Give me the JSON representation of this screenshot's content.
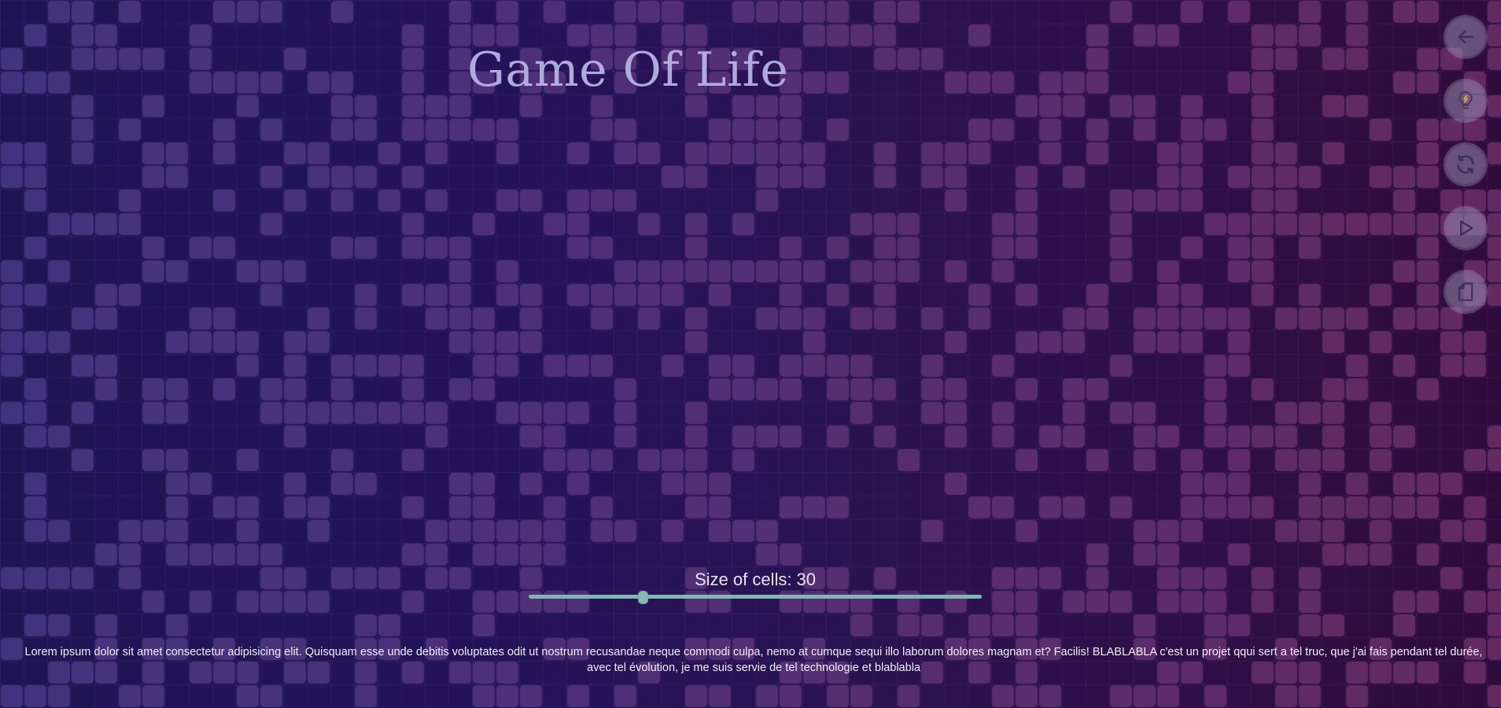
{
  "title": "Game Of Life",
  "controls": [
    {
      "name": "back",
      "icon": "arrow-left-icon"
    },
    {
      "name": "idea",
      "icon": "lightbulb-icon"
    },
    {
      "name": "refresh",
      "icon": "refresh-icon"
    },
    {
      "name": "play",
      "icon": "play-icon"
    },
    {
      "name": "document",
      "icon": "document-icon"
    }
  ],
  "slider": {
    "label": "Size of cells: 30",
    "value": 30,
    "min": 5,
    "max": 105
  },
  "footer": "Lorem ipsum dolor sit amet consectetur adipisicing elit. Quisquam esse unde debitis voluptates odit ut nostrum recusandae neque commodi culpa, nemo at cumque sequi illo laborum dolores magnam et? Facilis! BLABLABLA c'est un projet qqui sert a tel truc, que j'ai fais pendant tel durée, avec tel évolution, je me suis servie de tel technologie et blablabla",
  "colors": {
    "cell": "#5a4a9a",
    "background_left": "#1f1554",
    "background_right": "#2f0b3c",
    "slider_accent": "#7fb7b4"
  }
}
